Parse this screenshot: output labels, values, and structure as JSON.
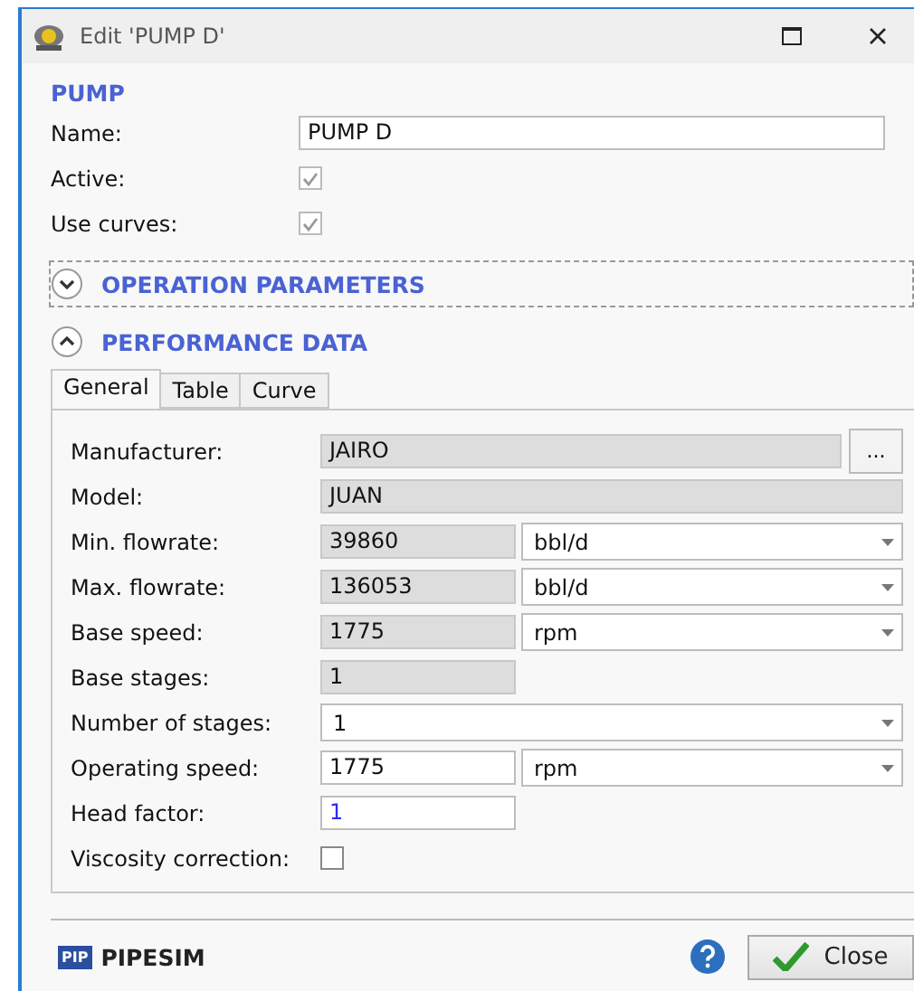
{
  "window": {
    "title": "Edit 'PUMP D'"
  },
  "pump": {
    "heading": "PUMP",
    "fields": [
      {
        "kind": "text",
        "label": "Name:",
        "value": "PUMP D"
      },
      {
        "kind": "checkbox",
        "label": "Active:",
        "checked": true,
        "disabled": true
      },
      {
        "kind": "checkbox",
        "label": "Use curves:",
        "checked": true,
        "disabled": true
      }
    ]
  },
  "sections": [
    {
      "title": "OPERATION PARAMETERS",
      "expanded": false,
      "focused": true
    },
    {
      "title": "PERFORMANCE DATA",
      "expanded": true,
      "focused": false
    }
  ],
  "tabs": [
    {
      "label": "General",
      "selected": true
    },
    {
      "label": "Table",
      "selected": false
    },
    {
      "label": "Curve",
      "selected": false
    }
  ],
  "general_fields": [
    {
      "kind": "browse",
      "label": "Manufacturer:",
      "value": "JAIRO",
      "button": "..."
    },
    {
      "kind": "readonly_wide",
      "label": "Model:",
      "value": "JUAN"
    },
    {
      "kind": "readonly",
      "label": "Min. flowrate:",
      "value": "39860",
      "unit": "bbl/d"
    },
    {
      "kind": "readonly",
      "label": "Max. flowrate:",
      "value": "136053",
      "unit": "bbl/d"
    },
    {
      "kind": "readonly",
      "label": "Base speed:",
      "value": "1775",
      "unit": "rpm"
    },
    {
      "kind": "readonly",
      "label": "Base stages:",
      "value": "1"
    },
    {
      "kind": "select",
      "label": "Number of stages:",
      "value": "1"
    },
    {
      "kind": "text",
      "label": "Operating speed:",
      "value": "1775",
      "unit": "rpm"
    },
    {
      "kind": "text",
      "label": "Head factor:",
      "value": "1",
      "modified": true
    },
    {
      "kind": "checkbox",
      "label": "Viscosity correction:",
      "checked": false,
      "disabled": false
    }
  ],
  "footer": {
    "logo_mark": "PIP",
    "brand": "PIPESIM",
    "close_button": "Close"
  }
}
